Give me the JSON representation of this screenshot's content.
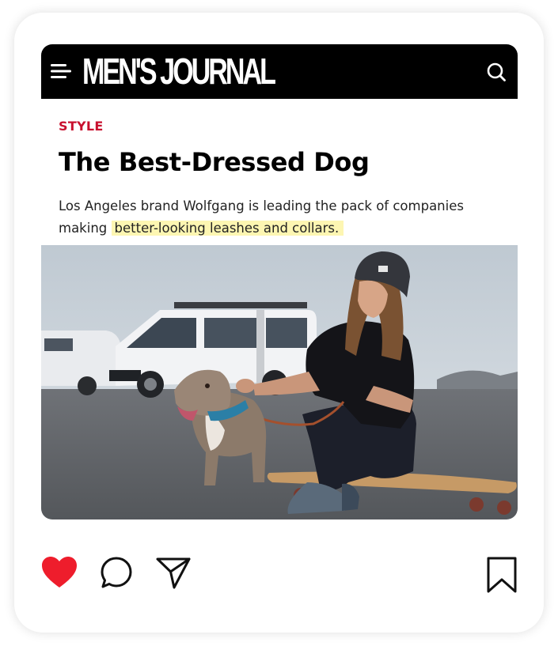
{
  "header": {
    "logo_text": "MEN'S JOURNAL",
    "menu_icon": "menu-icon",
    "search_icon": "search-icon"
  },
  "article": {
    "category": "STYLE",
    "headline": "The Best-Dressed Dog",
    "dek_plain": "Los Angeles brand Wolfgang is leading the pack of companies making ",
    "dek_highlight": "better-looking leashes and collars.",
    "image_subject": "photo-man-on-longboard-with-dog"
  },
  "actions": {
    "like_icon": "heart-icon",
    "comment_icon": "comment-icon",
    "share_icon": "send-icon",
    "save_icon": "bookmark-icon"
  },
  "colors": {
    "category": "#c8102e",
    "highlight": "#fdf6b2",
    "header_bg": "#000000",
    "like": "#ee1d2c"
  }
}
